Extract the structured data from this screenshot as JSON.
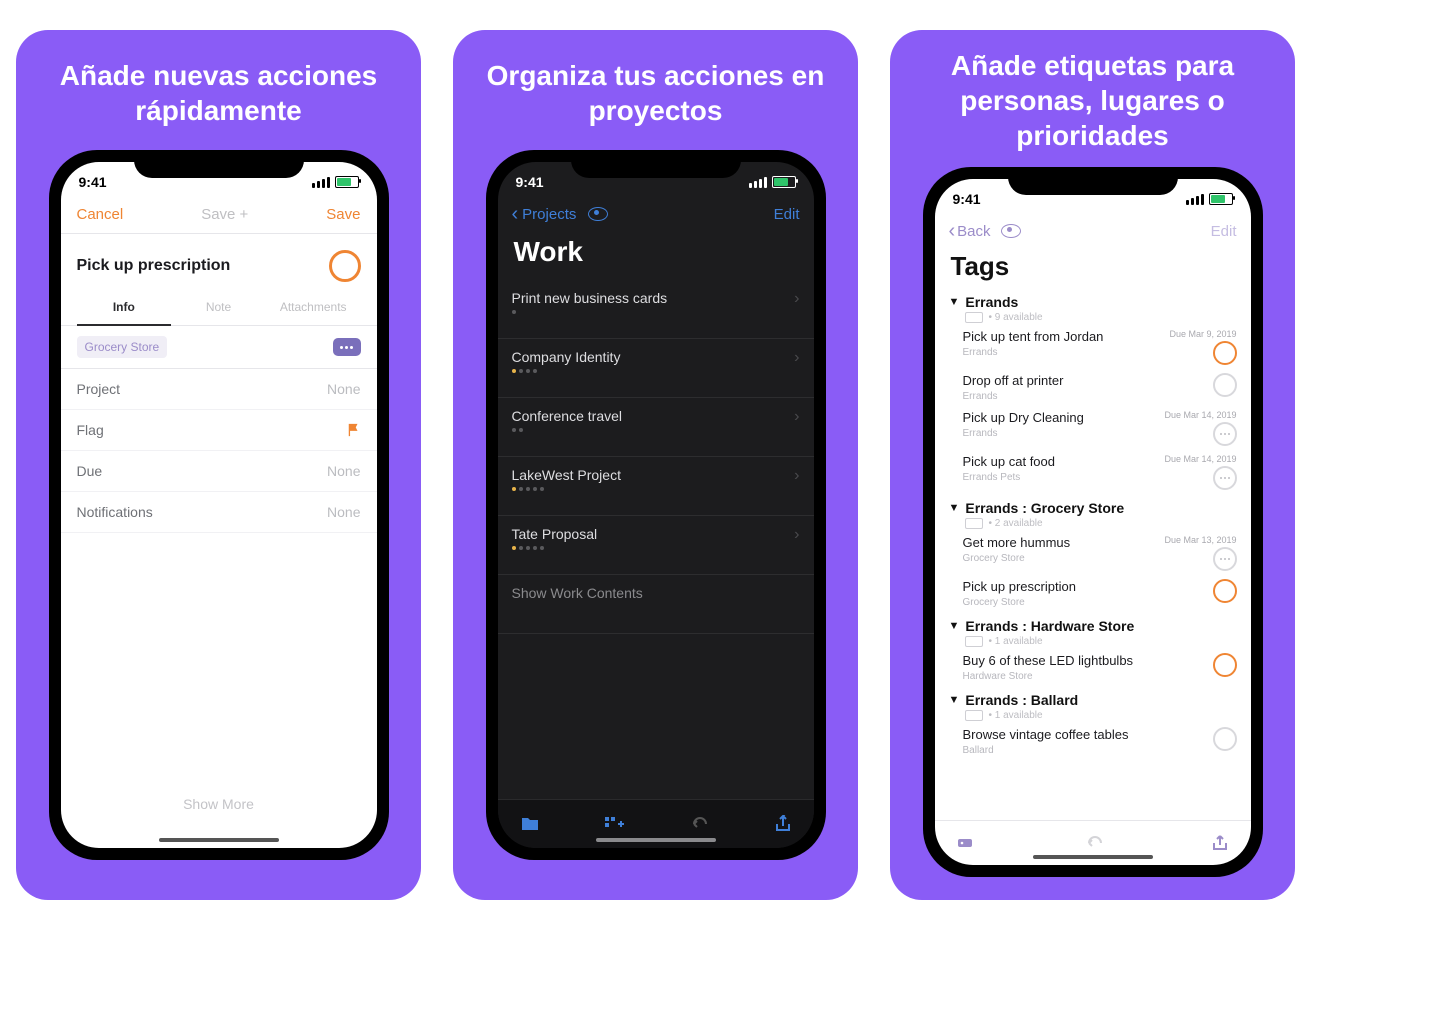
{
  "status_time": "9:41",
  "cards": {
    "0": {
      "headline": "Añade nuevas acciones rápidamente"
    },
    "1": {
      "headline": "Organiza tus acciones en proyectos"
    },
    "2": {
      "headline": "Añade etiquetas para personas, lugares o prioridades"
    }
  },
  "s1": {
    "nav": {
      "cancel": "Cancel",
      "save_plus": "Save +",
      "save": "Save"
    },
    "title": "Pick up prescription",
    "tabs": {
      "info": "Info",
      "note": "Note",
      "attachments": "Attachments"
    },
    "chip": "Grocery Store",
    "fields": {
      "project": {
        "label": "Project",
        "value": "None"
      },
      "flag": {
        "label": "Flag"
      },
      "due": {
        "label": "Due",
        "value": "None"
      },
      "notifications": {
        "label": "Notifications",
        "value": "None"
      }
    },
    "show_more": "Show More"
  },
  "s2": {
    "nav": {
      "back": "Projects",
      "edit": "Edit"
    },
    "title": "Work",
    "items": [
      {
        "title": "Print new business cards"
      },
      {
        "title": "Company Identity"
      },
      {
        "title": "Conference travel"
      },
      {
        "title": "LakeWest Project"
      },
      {
        "title": "Tate Proposal"
      },
      {
        "title": "Show Work Contents"
      }
    ]
  },
  "s3": {
    "nav": {
      "back": "Back",
      "edit": "Edit"
    },
    "title": "Tags",
    "sections": [
      {
        "name": "Errands",
        "available": "9 available",
        "items": [
          {
            "title": "Pick up tent from Jordan",
            "meta": "Errands",
            "due": "Due Mar 9, 2019",
            "icon": "flag"
          },
          {
            "title": "Drop off at printer",
            "meta": "Errands",
            "icon": "circle"
          },
          {
            "title": "Pick up Dry Cleaning",
            "meta": "Errands",
            "due": "Due Mar 14, 2019",
            "icon": "ell"
          },
          {
            "title": "Pick up cat food",
            "meta": "Errands  Pets",
            "due": "Due Mar 14, 2019",
            "icon": "ell"
          }
        ]
      },
      {
        "name": "Errands : Grocery Store",
        "available": "2 available",
        "items": [
          {
            "title": "Get more hummus",
            "meta": "Grocery Store",
            "due": "Due Mar 13, 2019",
            "icon": "ell"
          },
          {
            "title": "Pick up prescription",
            "meta": "Grocery Store",
            "icon": "flag"
          }
        ]
      },
      {
        "name": "Errands : Hardware Store",
        "available": "1 available",
        "items": [
          {
            "title": "Buy 6 of these LED lightbulbs",
            "meta": "Hardware Store",
            "icon": "flag"
          }
        ]
      },
      {
        "name": "Errands : Ballard",
        "available": "1 available",
        "items": [
          {
            "title": "Browse vintage coffee tables",
            "meta": "Ballard",
            "icon": "circle"
          }
        ]
      }
    ]
  }
}
